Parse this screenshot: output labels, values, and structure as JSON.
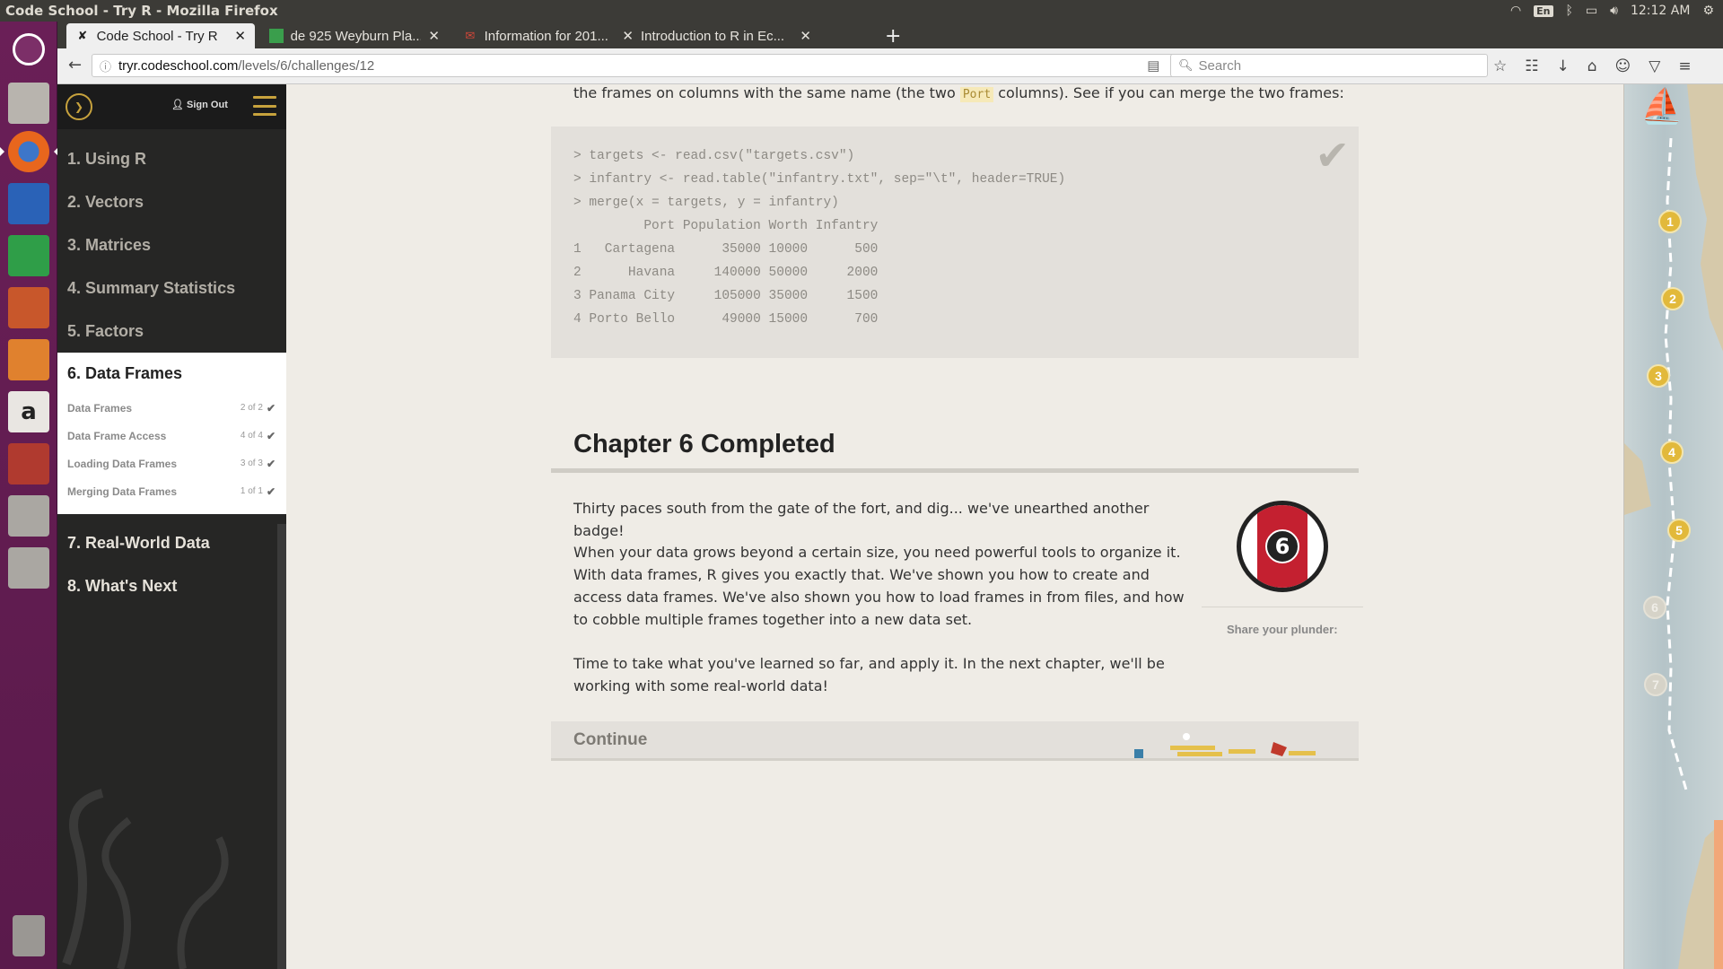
{
  "os": {
    "window_title": "Code School - Try R - Mozilla Firefox",
    "keyboard_layout": "En",
    "clock": "12:12 AM"
  },
  "browser": {
    "tabs": [
      {
        "title": "Code School - Try R",
        "active": true
      },
      {
        "title": "de 925 Weyburn Pla...",
        "active": false
      },
      {
        "title": "Information for 201...",
        "active": false
      },
      {
        "title": "Introduction to R in Ec...",
        "active": false
      }
    ],
    "url_host": "tryr.codeschool.com",
    "url_path": "/levels/6/challenges/12",
    "search_placeholder": "Search"
  },
  "sidebar": {
    "sign_out": "Sign Out",
    "chapters_before": [
      {
        "label": "1. Using R"
      },
      {
        "label": "2. Vectors"
      },
      {
        "label": "3. Matrices"
      },
      {
        "label": "4. Summary Statistics"
      },
      {
        "label": "5. Factors"
      }
    ],
    "current": {
      "label": "6. Data Frames",
      "lessons": [
        {
          "label": "Data Frames",
          "count": "2 of 2"
        },
        {
          "label": "Data Frame Access",
          "count": "4 of 4"
        },
        {
          "label": "Loading Data Frames",
          "count": "3 of 3"
        },
        {
          "label": "Merging Data Frames",
          "count": "1 of 1"
        }
      ]
    },
    "chapters_after": [
      {
        "label": "7. Real-World Data"
      },
      {
        "label": "8. What's Next"
      }
    ]
  },
  "content": {
    "intro_before": "the frames on columns with the same name (the two ",
    "intro_code": "Port",
    "intro_after": " columns). See if you can merge the two frames:",
    "console_lines": [
      "> targets <- read.csv(\"targets.csv\")",
      "> infantry <- read.table(\"infantry.txt\", sep=\"\\t\", header=TRUE)",
      "> merge(x = targets, y = infantry)",
      "         Port Population Worth Infantry",
      "1   Cartagena      35000 10000      500",
      "2      Havana     140000 50000     2000",
      "3 Panama City     105000 35000     1500",
      "4 Porto Bello      49000 15000      700"
    ],
    "chapter_title": "Chapter 6 Completed",
    "paragraph1": "Thirty paces south from the gate of the fort, and dig... we've unearthed another badge!",
    "paragraph2": "When your data grows beyond a certain size, you need powerful tools to organize it. With data frames, R gives you exactly that. We've shown you how to create and access data frames. We've also shown you how to load frames in from files, and how to cobble multiple frames together into a new data set.",
    "paragraph3": "Time to take what you've learned so far, and apply it. In the next chapter, we'll be working with some real-world data!",
    "badge_number": "6",
    "share_label": "Share your plunder:",
    "continue_label": "Continue"
  },
  "map": {
    "stops": [
      "1",
      "2",
      "3",
      "4",
      "5",
      "6",
      "7"
    ],
    "completed_count": 5
  }
}
